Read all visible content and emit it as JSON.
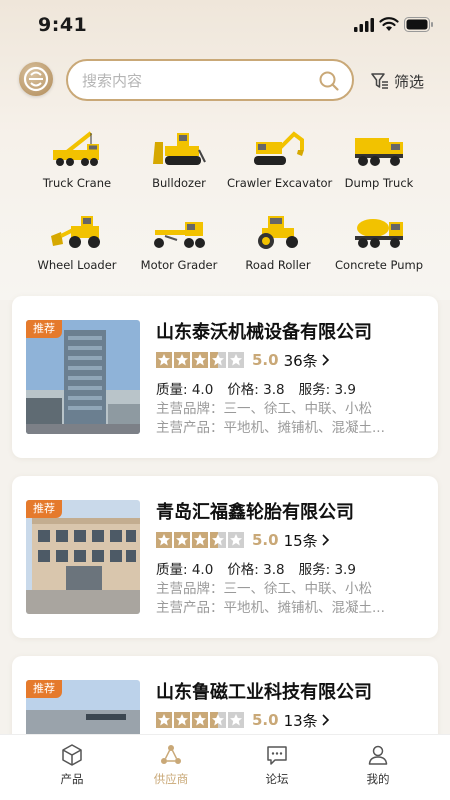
{
  "status_bar": {
    "time": "9:41"
  },
  "search": {
    "placeholder": "搜索内容"
  },
  "filter": {
    "label": "筛选"
  },
  "categories": [
    {
      "label": "Truck Crane",
      "icon": "truck-crane"
    },
    {
      "label": "Bulldozer",
      "icon": "bulldozer"
    },
    {
      "label": "Crawler Excavator",
      "icon": "crawler-excavator"
    },
    {
      "label": "Dump Truck",
      "icon": "dump-truck"
    },
    {
      "label": "Wheel Loader",
      "icon": "wheel-loader"
    },
    {
      "label": "Motor Grader",
      "icon": "motor-grader"
    },
    {
      "label": "Road Roller",
      "icon": "road-roller"
    },
    {
      "label": "Concrete Pump",
      "icon": "concrete-pump"
    }
  ],
  "suppliers": [
    {
      "badge": "推荐",
      "name": "山东泰沃机械设备有限公司",
      "rating_stars": 3.5,
      "score": "5.0",
      "count": "36条",
      "quality": "质量: 4.0",
      "price": "价格: 3.8",
      "service": "服务: 3.9",
      "brands": "主营品牌：三一、徐工、中联、小松",
      "products": "主营产品：平地机、摊铺机、混凝土..."
    },
    {
      "badge": "推荐",
      "name": "青岛汇福鑫轮胎有限公司",
      "rating_stars": 3.5,
      "score": "5.0",
      "count": "15条",
      "quality": "质量: 4.0",
      "price": "价格: 3.8",
      "service": "服务: 3.9",
      "brands": "主营品牌：三一、徐工、中联、小松",
      "products": "主营产品：平地机、摊铺机、混凝土..."
    },
    {
      "badge": "推荐",
      "name": "山东鲁磁工业科技有限公司",
      "rating_stars": 3.5,
      "score": "5.0",
      "count": "13条"
    }
  ],
  "tabs": [
    {
      "label": "产品",
      "icon": "cube-icon",
      "active": false
    },
    {
      "label": "供应商",
      "icon": "supplier-icon",
      "active": true
    },
    {
      "label": "论坛",
      "icon": "chat-icon",
      "active": false
    },
    {
      "label": "我的",
      "icon": "user-icon",
      "active": false
    }
  ],
  "colors": {
    "accent": "#c9a877",
    "badge": "#e57a2c",
    "star_empty": "#cfcfcf"
  }
}
